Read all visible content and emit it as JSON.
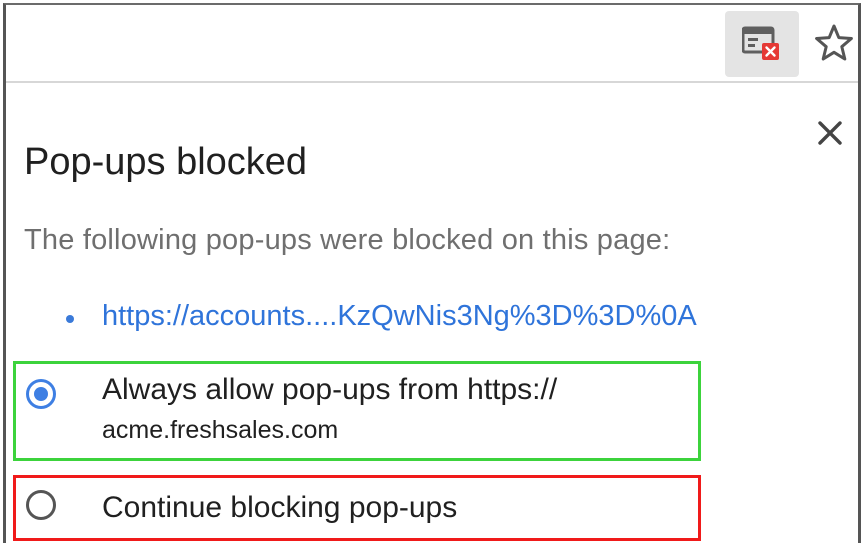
{
  "toolbar": {
    "popup_blocked_icon": "popup-blocked-icon",
    "bookmark_icon": "star-outline-icon"
  },
  "bubble": {
    "title": "Pop-ups blocked",
    "description": "The following pop-ups were blocked on this page:",
    "blocked_items": [
      {
        "url": "https://accounts....KzQwNis3Ng%3D%3D%0A"
      }
    ],
    "options": [
      {
        "label_line1": "Always allow pop-ups from https://",
        "label_line2": "acme.freshsales.com",
        "selected": true
      },
      {
        "label": "Continue blocking pop-ups",
        "selected": false
      }
    ],
    "close_icon": "close-icon"
  },
  "colors": {
    "link": "#2f74da",
    "radio_accent": "#3e7fe3",
    "allow_highlight": "#3cd33c",
    "block_highlight": "#f01a1a",
    "blocked_badge": "#e53935"
  }
}
